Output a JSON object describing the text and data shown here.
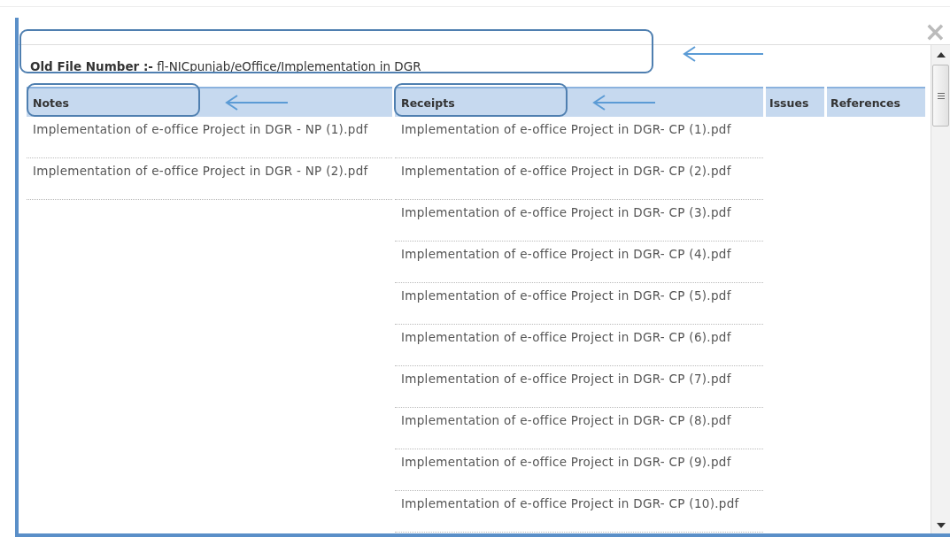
{
  "file_number": "**Old File Number :-** fl-NICpunjab/eOffice/Implementation in DGR",
  "close_button": "×",
  "columns": [
    {
      "header": "Notes",
      "items": [
        "Implementation of e-office Project in DGR - NP (1).pdf",
        "Implementation of e-office Project in DGR - NP (2).pdf"
      ]
    },
    {
      "header": "Receipts",
      "items": [
        "Implementation of e-office Project in DGR- CP (1).pdf",
        "Implementation of e-office Project in DGR- CP (2).pdf",
        "Implementation of e-office Project in DGR- CP (3).pdf",
        "Implementation of e-office Project in DGR- CP (4).pdf",
        "Implementation of e-office Project in DGR- CP (5).pdf",
        "Implementation of e-office Project in DGR- CP (6).pdf",
        "Implementation of e-office Project in DGR- CP (7).pdf",
        "Implementation of e-office Project in DGR- CP (8).pdf",
        "Implementation of e-office Project in DGR- CP (9).pdf",
        "Implementation of e-office Project in DGR- CP (10).pdf"
      ]
    },
    {
      "header": "Issues"
    },
    {
      "header": "References"
    }
  ]
}
